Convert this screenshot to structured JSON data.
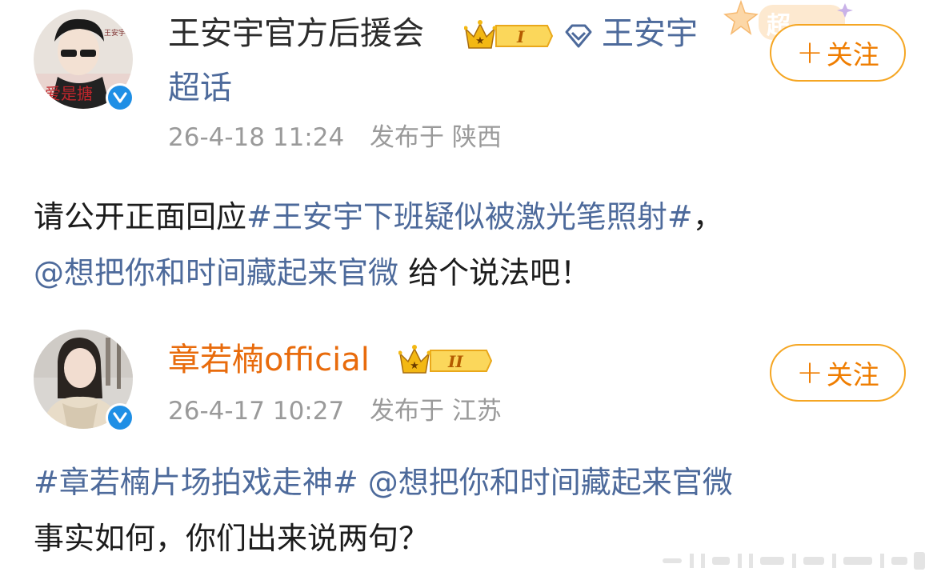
{
  "posts": [
    {
      "author": "王安宇官方后援会",
      "level_badge": "I",
      "topic_icon": "diamond-icon",
      "topic_link": "王安宇",
      "topic_suffix": "超话",
      "time": "26-4-18 11:24",
      "location": "发布于 陕西",
      "follow_label": "关注",
      "text_line1_prefix": "请公开正面回应",
      "text_line1_hashtag": "#王安宇下班疑似被激光笔照射#",
      "text_line1_suffix": "，",
      "text_line2_mention": "@想把你和时间藏起来官微",
      "text_line2_suffix": " 给个说法吧！"
    },
    {
      "author": "章若楠official",
      "level_badge": "II",
      "time": "26-4-17 10:27",
      "location": "发布于 江苏",
      "follow_label": "关注",
      "text_line1_hashtag": "#章若楠片场拍戏走神#",
      "text_line1_mention": "@想把你和时间藏起来官微",
      "text_line2": "事实如何，你们出来说两句？"
    }
  ],
  "colors": {
    "link": "#4d6a9b",
    "orange_name": "#e86b0c",
    "follow_border": "#f5a623",
    "verified": "#1f8fe5",
    "meta_gray": "#9a9a9a"
  }
}
